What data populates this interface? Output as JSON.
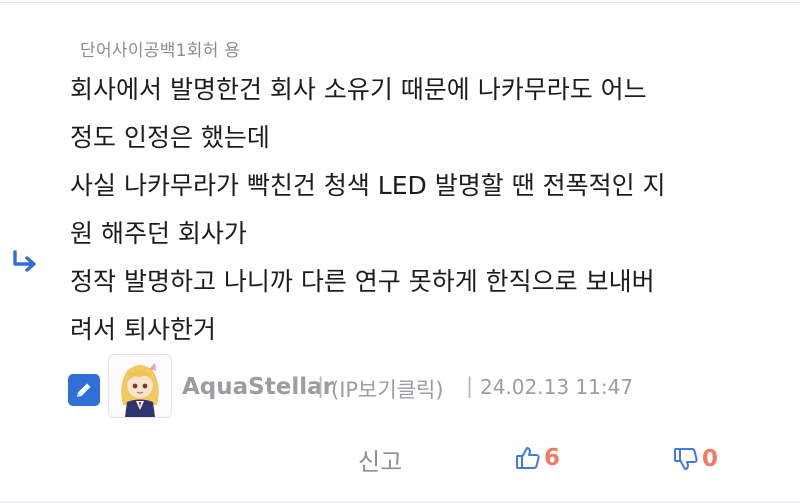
{
  "comment": {
    "tag": "단어사이공백1회허 용",
    "lines": [
      "회사에서 발명한건 회사 소유기 때문에 나카무라도 어느",
      "정도 인정은 했는데",
      "사실 나카무라가 빡친건 청색 LED 발명할 땐 전폭적인 지",
      "원 해주던 회사가",
      "정작 발명하고 나니까 다른 연구 못하게 한직으로 보내버",
      "려서 퇴사한거"
    ]
  },
  "meta": {
    "author": "AquaStellar",
    "separator": "|",
    "ip_view": "(IP보기클릭)",
    "timestamp": "24.02.13 11:47"
  },
  "actions": {
    "report_label": "신고",
    "like_count": "6",
    "dislike_count": "0"
  },
  "icons": {
    "reply": "reply-arrow-icon",
    "edit": "pencil-icon",
    "like": "thumbs-up-icon",
    "dislike": "thumbs-down-icon"
  },
  "colors": {
    "accent_blue": "#2f6fd6",
    "count_orange": "#f07a63",
    "muted_gray": "#9a9da2"
  }
}
